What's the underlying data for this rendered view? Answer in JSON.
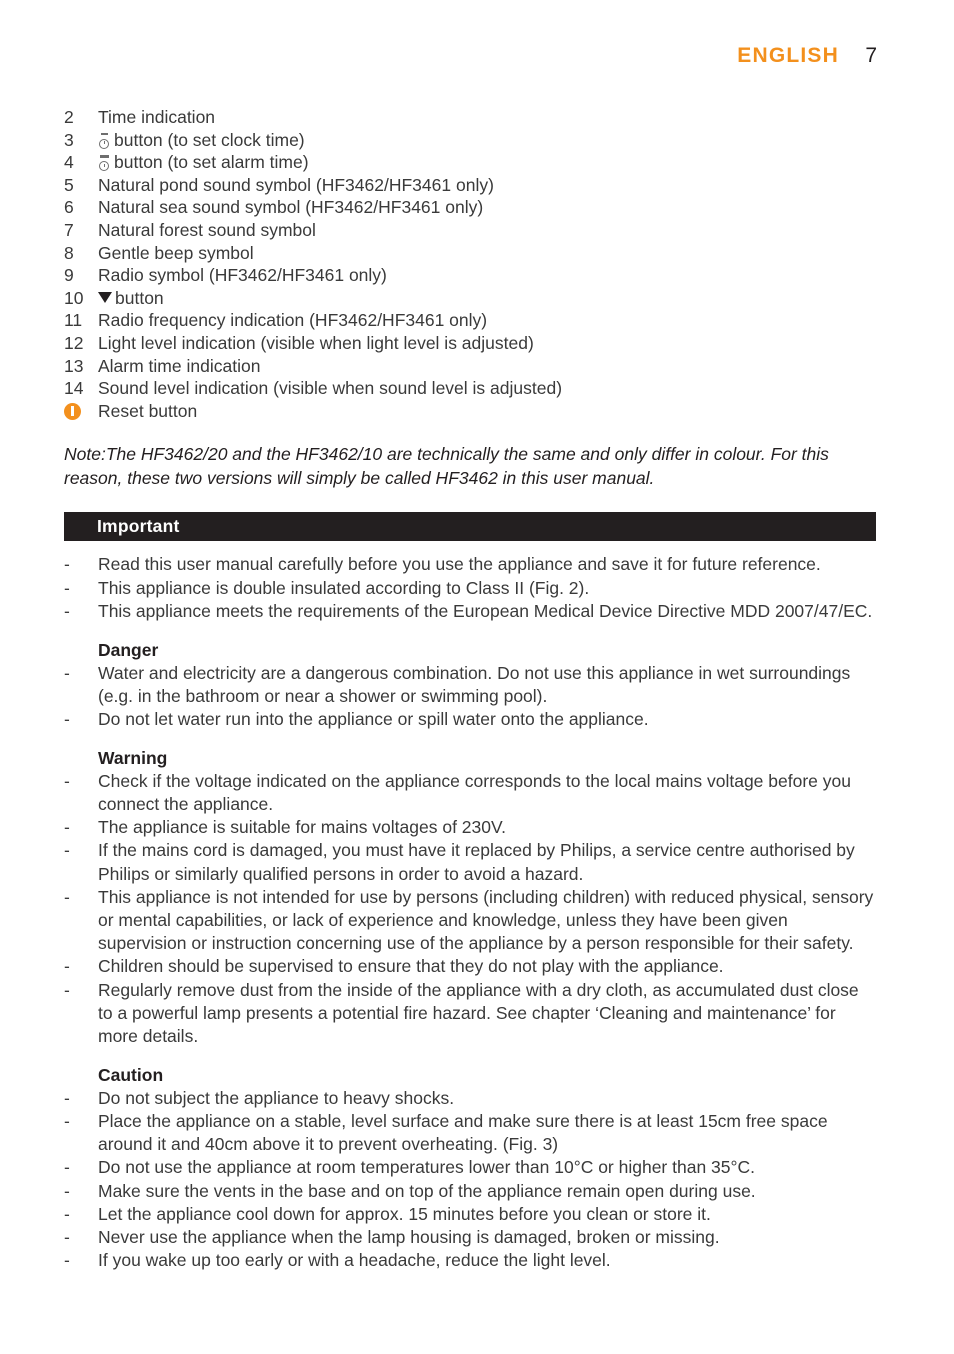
{
  "header": {
    "language": "ENGLISH",
    "page_number": "7"
  },
  "legend": {
    "items": [
      {
        "key": "2",
        "icon": "none",
        "text": "Time indication"
      },
      {
        "key": "3",
        "icon": "clock-icon",
        "text": "button (to set clock time)"
      },
      {
        "key": "4",
        "icon": "alarm-clock-icon",
        "text": "button (to set alarm time)"
      },
      {
        "key": "5",
        "icon": "none",
        "text": "Natural pond sound symbol (HF3462/HF3461 only)"
      },
      {
        "key": "6",
        "icon": "none",
        "text": "Natural sea sound symbol (HF3462/HF3461 only)"
      },
      {
        "key": "7",
        "icon": "none",
        "text": "Natural forest sound symbol"
      },
      {
        "key": "8",
        "icon": "none",
        "text": "Gentle beep symbol"
      },
      {
        "key": "9",
        "icon": "none",
        "text": "Radio symbol (HF3462/HF3461 only)"
      },
      {
        "key": "10",
        "icon": "triangle-down-icon",
        "text": "button"
      },
      {
        "key": "11",
        "icon": "none",
        "text": "Radio frequency indication (HF3462/HF3461 only)"
      },
      {
        "key": "12",
        "icon": "none",
        "text": "Light level indication (visible when light level is adjusted)"
      },
      {
        "key": "13",
        "icon": "none",
        "text": "Alarm time indication"
      },
      {
        "key": "14",
        "icon": "none",
        "text": "Sound level indication (visible when sound level is adjusted)"
      },
      {
        "key": "",
        "icon": "reset-badge-icon",
        "text": "Reset button"
      }
    ]
  },
  "note": {
    "line1": "Note:The HF3462/20 and the HF3462/10 are technically the same and only differ in colour. For this",
    "line2": "reason, these two versions will simply be called HF3462 in this user manual."
  },
  "important": {
    "bar_title": "Important",
    "bullets": [
      "Read this user manual carefully before you use the appliance and save it for future reference.",
      "This appliance is double insulated according to Class II (Fig. 2).",
      "This appliance meets the requirements of the European Medical Device Directive MDD 2007/47/EC."
    ]
  },
  "danger": {
    "heading": "Danger",
    "bullets": [
      "Water and electricity are a dangerous combination. Do not use this appliance in wet surroundings (e.g. in the bathroom or near a shower or swimming pool).",
      "Do not let water run into the appliance or spill water onto the appliance."
    ]
  },
  "warning": {
    "heading": "Warning",
    "bullets": [
      "Check if the voltage indicated on the appliance corresponds to the local mains voltage before you connect the appliance.",
      "The appliance is suitable for mains voltages of 230V.",
      "If the mains cord is damaged, you must have it replaced by Philips, a service centre authorised by Philips or similarly qualified persons in order to avoid a hazard.",
      "This appliance is not intended for use by persons (including children) with reduced physical, sensory or mental capabilities, or lack of experience and knowledge, unless they have been given supervision or instruction concerning use of the appliance by a person responsible for their safety.",
      "Children should be supervised to ensure that they do not play with the appliance.",
      "Regularly remove dust from the inside of the appliance with a dry cloth, as accumulated dust close to a powerful lamp presents a potential fire hazard. See chapter ‘Cleaning and maintenance’ for more details."
    ]
  },
  "caution": {
    "heading": "Caution",
    "bullets": [
      "Do not subject the appliance to heavy shocks.",
      "Place the appliance on a stable, level surface and make sure there is at least 15cm free space around it and 40cm above it to prevent overheating.  (Fig. 3)",
      "Do not use the appliance at room temperatures lower than 10°C or higher than 35°C.",
      "Make sure the vents in the base and on top of the appliance remain open during use.",
      "Let the appliance cool down for approx. 15 minutes before you clean or store it.",
      "Never use the appliance when the lamp housing is damaged, broken or missing.",
      "If you wake up too early or with a headache, reduce the light level."
    ]
  },
  "symbols": {
    "bullet_dash": "-"
  },
  "colors": {
    "accent_orange": "#F3901D",
    "bar_black": "#231f20",
    "body_text": "#3a3a3a"
  }
}
